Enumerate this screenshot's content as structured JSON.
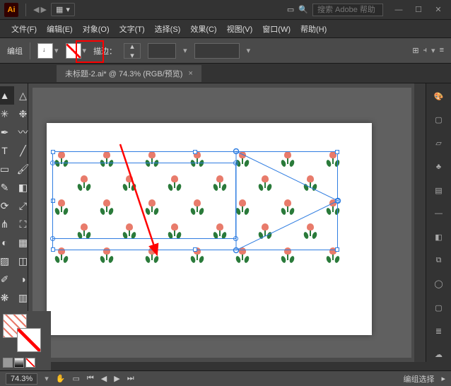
{
  "app": {
    "name": "Ai"
  },
  "search": {
    "placeholder": "搜索 Adobe 帮助"
  },
  "win": {
    "min": "—",
    "max": "☐",
    "close": "✕"
  },
  "menu": {
    "file": "文件(F)",
    "edit": "编辑(E)",
    "object": "对象(O)",
    "type": "文字(T)",
    "select": "选择(S)",
    "effect": "效果(C)",
    "view": "视图(V)",
    "window": "窗口(W)",
    "help": "帮助(H)"
  },
  "control": {
    "mode": "编组",
    "stroke_label": "描边：",
    "stroke_weight": "",
    "opacity": ""
  },
  "document": {
    "tab_title": "未标题-2.ai* @ 74.3% (RGB/预览)"
  },
  "status": {
    "zoom": "74.3%",
    "selection": "编组选择"
  },
  "panels": {
    "color": "color-panel",
    "swatches": "swatches-panel",
    "stroke": "stroke-panel",
    "symbols": "symbols-panel",
    "brushes": "brushes-panel",
    "align": "align-panel",
    "transform": "transform-panel",
    "appearance": "appearance-panel",
    "layers": "layers-panel",
    "libraries": "libraries-panel"
  },
  "tools": {
    "left": [
      "selection",
      "direct-selection",
      "magic-wand",
      "lasso",
      "pen",
      "curvature",
      "type",
      "line",
      "rectangle",
      "paintbrush",
      "shaper",
      "eraser",
      "rotate",
      "scale",
      "width",
      "free-transform",
      "shape-builder",
      "perspective",
      "mesh",
      "gradient",
      "eyedropper",
      "blend",
      "symbol-sprayer",
      "column-graph",
      "artboard",
      "slice",
      "hand",
      "zoom"
    ]
  },
  "icons": {
    "nav_left": "◀",
    "nav_right": "▶",
    "grid": "▦",
    "dd": "▾",
    "search": "🔍",
    "doc": "▭",
    "stepper_up": "▴",
    "stepper_down": "▾",
    "align1": "⊞",
    "align2": "⫞",
    "menu": "≡",
    "hand": "✋",
    "page": "▭",
    "tab_x": "×",
    "palette": "🎨",
    "square": "▢",
    "slash": "▱",
    "club": "♣",
    "hash": "▤",
    "ring": "◯",
    "cube": "◧",
    "layers": "≣",
    "cloud": "☁",
    "link": "⧉"
  }
}
